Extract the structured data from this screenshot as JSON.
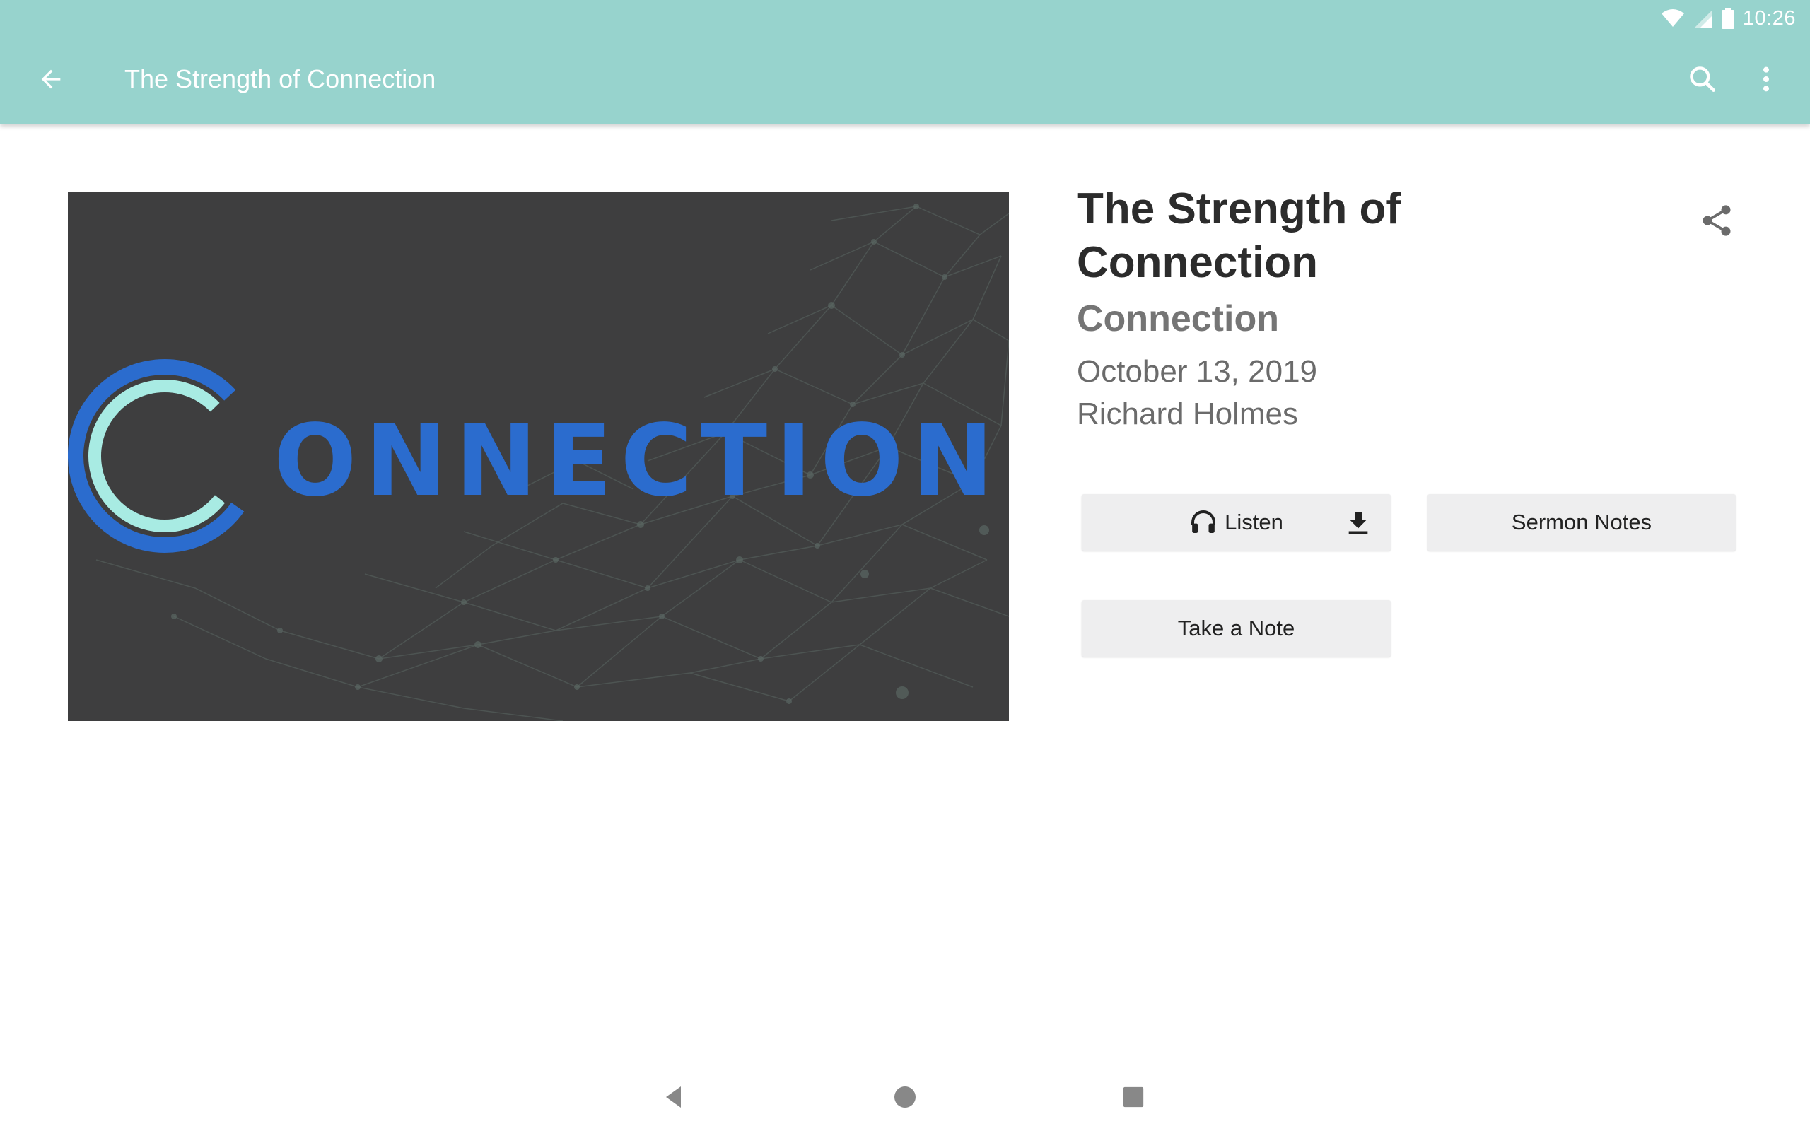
{
  "status_bar": {
    "time": "10:26",
    "icons": [
      "wifi-icon",
      "cell-signal-icon",
      "battery-icon"
    ]
  },
  "toolbar": {
    "title": "The Strength of Connection",
    "back_icon": "arrow-back-icon",
    "search_icon": "search-icon",
    "overflow_icon": "more-vert-icon"
  },
  "artwork": {
    "logo_text": "ONNECTION",
    "logo_colors": {
      "primary": "#2b6cce",
      "accent": "#a8ebe3",
      "background": "#3e3e3f"
    }
  },
  "sermon": {
    "title": "The Strength of Connection",
    "series": "Connection",
    "date": "October 13, 2019",
    "speaker": "Richard Holmes"
  },
  "actions": {
    "listen_label": "Listen",
    "listen_icon": "headphones-icon",
    "download_icon": "download-icon",
    "sermon_notes_label": "Sermon Notes",
    "take_note_label": "Take a Note",
    "share_icon": "share-icon"
  },
  "nav_bar": {
    "icons": [
      "nav-back-icon",
      "nav-home-icon",
      "nav-recents-icon"
    ]
  },
  "colors": {
    "app_bar": "#97d3cd",
    "button_bg": "#eeeeef",
    "title_text": "#2c2c2c",
    "secondary_text": "#6b6b6b"
  }
}
